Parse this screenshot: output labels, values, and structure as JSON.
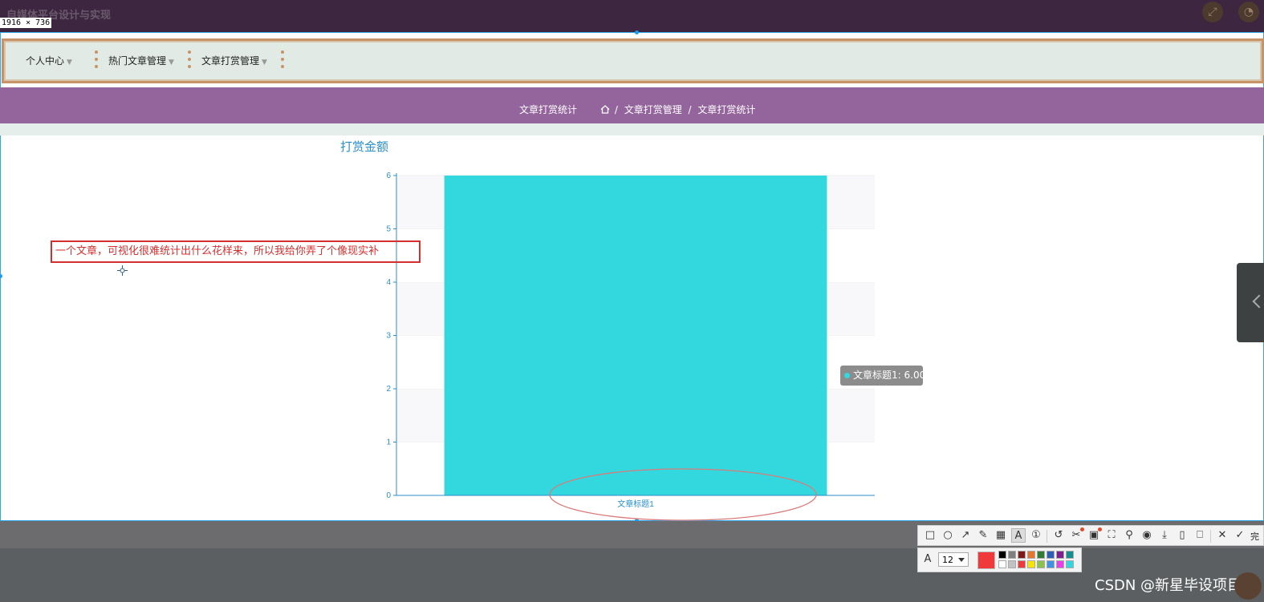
{
  "header": {
    "app_title": "自媒体平台设计与实现",
    "dimensions_label": "1916 × 736",
    "fullscreen_icon": "fullscreen-icon",
    "user_icon": "user-icon"
  },
  "nav": {
    "items": [
      {
        "label": "个人中心"
      },
      {
        "label": "热门文章管理"
      },
      {
        "label": "文章打赏管理"
      }
    ]
  },
  "breadcrumb": {
    "page_title": "文章打赏统计",
    "home_icon": "home-icon",
    "separator": "/",
    "items": [
      "文章打赏管理",
      "文章打赏统计"
    ]
  },
  "chart_data": {
    "type": "bar",
    "title": "打赏金额",
    "categories": [
      "文章标题1"
    ],
    "series": [
      {
        "values": [
          6
        ]
      }
    ],
    "ylim": [
      0,
      6
    ],
    "yticks": [
      "0",
      "1",
      "2",
      "3",
      "4",
      "5",
      "6"
    ],
    "bar_color": "#33d8de",
    "axis_color": "#2a8fc7",
    "grid": true,
    "tooltip": "文章标题1: 6.00"
  },
  "annotation": {
    "text": "一个文章，可视化很难统计出什么花样来，所以我给你弄了个像现实补",
    "color": "#d42f2f"
  },
  "screenshot_toolbar": {
    "tools": [
      "rectangle-tool-icon",
      "ellipse-tool-icon",
      "arrow-tool-icon",
      "pencil-tool-icon",
      "mosaic-tool-icon",
      "text-tool-icon",
      "number-tool-icon",
      "undo-icon",
      "ocr-icon",
      "translate-icon",
      "scroll-capture-icon",
      "pin-icon",
      "record-icon",
      "download-icon",
      "save-icon",
      "bookmark-icon",
      "close-icon",
      "confirm-icon"
    ],
    "done_label": "完",
    "font_size_value": "12",
    "current_color": "#f0393a",
    "palette_top": [
      "#000000",
      "#7f7f7f",
      "#7f1a1a",
      "#e7752c",
      "#2f7d32",
      "#2e5fb8",
      "#7e1f8f",
      "#138f8f"
    ],
    "palette_bottom": [
      "#ffffff",
      "#c2c2c2",
      "#f0393a",
      "#f7e300",
      "#8bc34a",
      "#3d93e6",
      "#e83fe8",
      "#35d5e0"
    ]
  },
  "watermark": "CSDN @新星毕设项目"
}
